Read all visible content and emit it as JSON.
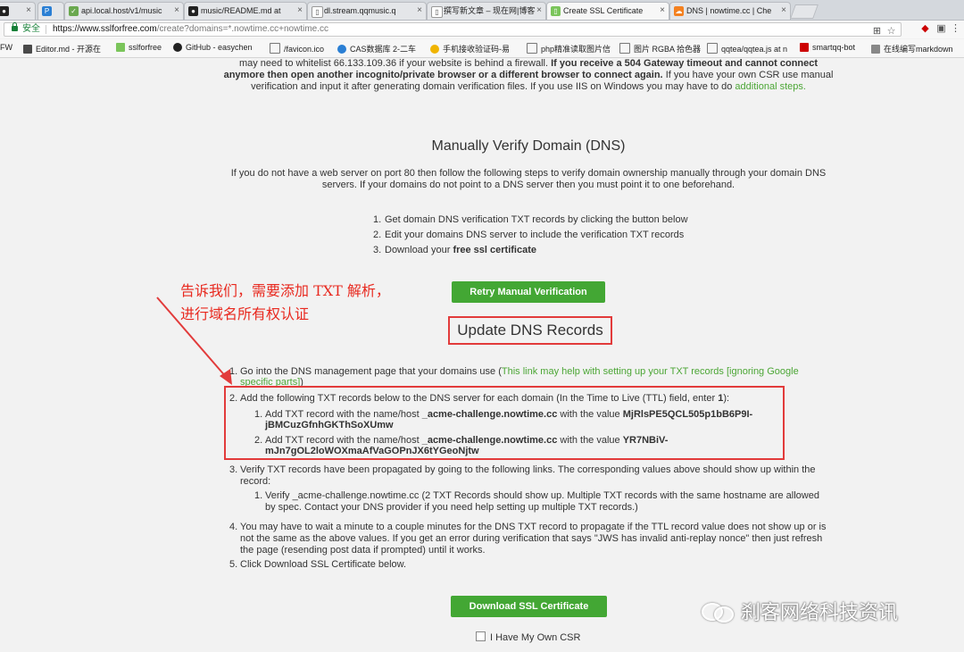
{
  "tabs": [
    {
      "label": "",
      "icon": "github-icon"
    },
    {
      "label": "",
      "icon": "p-icon"
    },
    {
      "label": "api.local.host/v1/music",
      "icon": "doc-icon"
    },
    {
      "label": "music/README.md at",
      "icon": "github-icon"
    },
    {
      "label": "dl.stream.qqmusic.q",
      "icon": "doc-icon"
    },
    {
      "label": "撰写新文章 – 现在网|博客",
      "icon": "doc-icon"
    },
    {
      "label": "Create SSL Certificate",
      "icon": "doc-icon"
    },
    {
      "label": "DNS | nowtime.cc | Che",
      "icon": "cloudflare-icon"
    }
  ],
  "address_bar": {
    "secure_label": "安全",
    "url_main": "https://www.sslforfree.com",
    "url_rest": "/create?domains=*.nowtime.cc+nowtime.cc"
  },
  "bookmarks": [
    "FW",
    "Editor.md - 开源在",
    "sslforfree",
    "GitHub - easychen",
    "/favicon.ico",
    "CAS数据库 2-二车",
    "手机接收验证码-易",
    "php精准读取图片信",
    "图片 RGBA 拾色器",
    "qqtea/qqtea.js at n",
    "smartqq-bot",
    "在线编写markdown"
  ],
  "page": {
    "intro_line1": "may need to whitelist 66.133.109.36 if your website is behind a firewall.",
    "intro_bold1": "If you receive a 504 Gateway timeout and cannot connect",
    "intro_bold2": "anymore then open another incognito/private browser or a different browser to connect again.",
    "intro_line2b": "If you have your own CSR use manual",
    "intro_line3": "verification and input it after generating domain verification files. If you use IIS on Windows you may have to do",
    "intro_link": "additional steps.",
    "title": "Manually Verify Domain (DNS)",
    "desc_line1": "If you do not have a web server on port 80 then follow the following steps to verify domain ownership manually through your domain DNS",
    "desc_line2": "servers. If your domains do not point to a DNS server then you must point it to one beforehand.",
    "steps": [
      "Get domain DNS verification TXT records by clicking the button below",
      "Edit your domains DNS server to include the verification TXT records",
      "Download your"
    ],
    "steps_bold": "free ssl certificate",
    "retry_button": "Retry Manual Verification",
    "update_title": "Update DNS Records",
    "annotation_line1": "告诉我们，需要添加 TXT 解析，",
    "annotation_line2": "进行域名所有权认证",
    "list": {
      "item1": "Go into the DNS management page that your domains use (",
      "item1_link1": "This link may help with setting up your TXT records [ignoring Google",
      "item1_link2": "specific parts]",
      "item1_end": ")",
      "item2": "Add the following TXT records below to the DNS server for each domain (In the Time to Live (TTL) field, enter",
      "item2_ttl": "1",
      "item2_end": "):",
      "sub1_pre": "Add TXT record with the name/host",
      "sub1_host": "_acme-challenge.nowtime.cc",
      "sub1_mid": "with the value",
      "sub1_val1": "MjRlsPE5QCL505p1bB6P9I-",
      "sub1_val2": "jBMCuzGfnhGKThSoXUmw",
      "sub2_pre": "Add TXT record with the name/host",
      "sub2_host": "_acme-challenge.nowtime.cc",
      "sub2_mid": "with the value",
      "sub2_val1": "YR7NBiV-",
      "sub2_val2": "mJn7gOL2loWOXmaAfVaGOPnJX6tYGeoNjtw",
      "item3_line1": "Verify TXT records have been propagated by going to the following links. The corresponding values above should show up within the",
      "item3_line2": "record:",
      "item3_sub1": "Verify _acme-challenge.nowtime.cc (2 TXT Records should show up. Multiple TXT records with the same hostname are allowed",
      "item3_sub2": "by spec. Contact your DNS provider if you need help setting up multiple TXT records.)",
      "item4_line1": "You may have to wait a minute to a couple minutes for the DNS TXT record to propagate if the TTL record value does not show up or is",
      "item4_line2": "not the same as the above values. If you get an error during verification that says \"JWS has invalid anti-replay nonce\" then just refresh",
      "item4_line3": "the page (resending post data if prompted) until it works.",
      "item5": "Click Download SSL Certificate below."
    },
    "download_button": "Download SSL Certificate",
    "csr_label": "I Have My Own CSR",
    "watermark": "刹客网络科技资讯"
  },
  "colors": {
    "accent_green": "#43a734",
    "link_green": "#4ca636",
    "annotation_red": "#e23b3b"
  }
}
